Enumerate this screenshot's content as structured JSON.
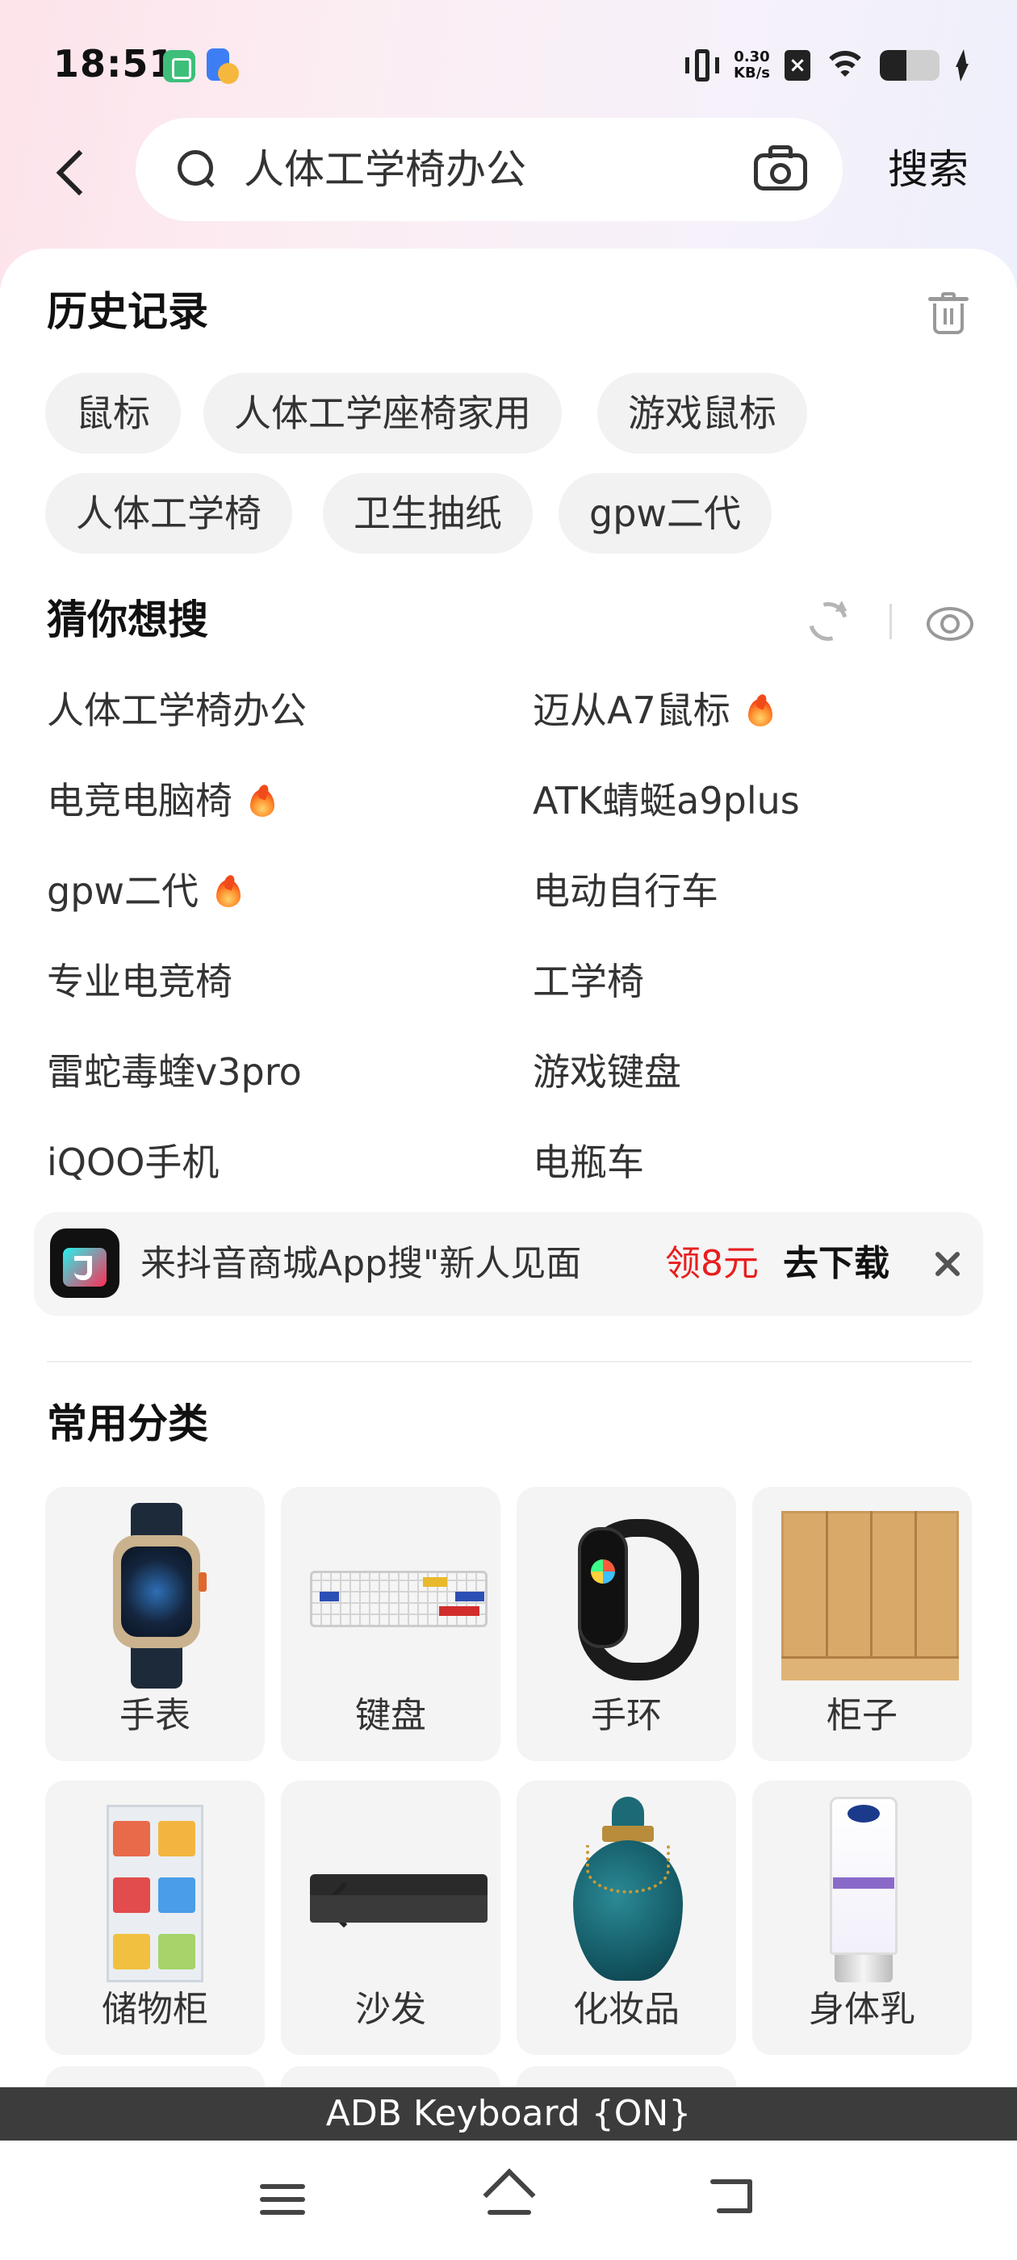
{
  "status_bar": {
    "time": "18:51",
    "net_speed_value": "0.30",
    "net_speed_unit": "KB/s",
    "battery_level": 0.45,
    "icons": [
      "app-notification-icon",
      "app-notification-icon",
      "vibrate-icon",
      "no-sim-icon",
      "wifi-icon",
      "battery-icon",
      "charging-icon"
    ]
  },
  "search": {
    "query": "人体工学椅办公",
    "submit_label": "搜索"
  },
  "history": {
    "title": "历史记录",
    "items": [
      "鼠标",
      "人体工学座椅家用",
      "游戏鼠标",
      "人体工学椅",
      "卫生抽纸",
      "gpw二代"
    ]
  },
  "guess": {
    "title": "猜你想搜",
    "items": [
      {
        "text": "人体工学椅办公",
        "hot": false
      },
      {
        "text": "迈从A7鼠标",
        "hot": true
      },
      {
        "text": "电竞电脑椅",
        "hot": true
      },
      {
        "text": "ATK蜻蜓a9plus",
        "hot": false
      },
      {
        "text": "gpw二代",
        "hot": true
      },
      {
        "text": "电动自行车",
        "hot": false
      },
      {
        "text": "专业电竞椅",
        "hot": false
      },
      {
        "text": "工学椅",
        "hot": false
      },
      {
        "text": "雷蛇毒蝰v3pro",
        "hot": false
      },
      {
        "text": "游戏键盘",
        "hot": false
      },
      {
        "text": "iQOO手机",
        "hot": false
      },
      {
        "text": "电瓶车",
        "hot": false
      }
    ]
  },
  "banner": {
    "text": "来抖音商城App搜\"新人见面",
    "reward": "领8元",
    "action": "去下载",
    "reward_color": "#e81f1f"
  },
  "categories": {
    "title": "常用分类",
    "items": [
      "手表",
      "键盘",
      "手环",
      "柜子",
      "储物柜",
      "沙发",
      "化妆品",
      "身体乳"
    ]
  },
  "keyboard_status": "ADB Keyboard {ON}"
}
